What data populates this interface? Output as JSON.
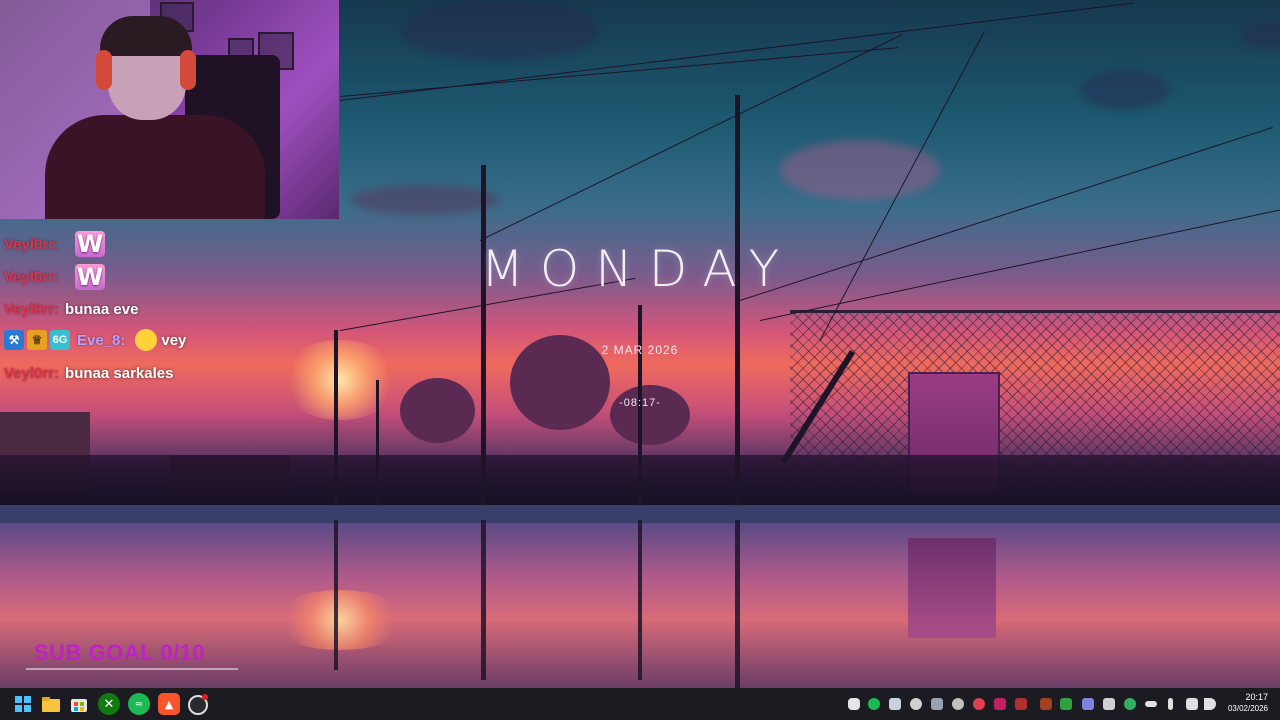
{
  "desktop": {
    "widget": {
      "day": "MONDAY",
      "date": "2 MAR 2026",
      "time": "-08:17-"
    }
  },
  "webcam": {
    "label": "streamer webcam"
  },
  "chat": {
    "messages": [
      {
        "user": "Veyl0rr:",
        "emote": "W",
        "text": ""
      },
      {
        "user": "Veyl0rr:",
        "emote": "W",
        "text": ""
      },
      {
        "user": "Veyl0rr:",
        "emote": "",
        "text": "bunaa eve"
      },
      {
        "user": "Eve_8:",
        "emote": "duck",
        "text": "vey",
        "badges": [
          "hammer",
          "crown",
          "6G"
        ]
      },
      {
        "user": "Veyl0rr:",
        "emote": "",
        "text": "bunaa sarkales"
      }
    ]
  },
  "overlay": {
    "sub_goal": "SUB GOAL 0/10"
  },
  "taskbar": {
    "pinned": [
      "windows-start",
      "file-explorer",
      "microsoft-store",
      "xbox",
      "spotify",
      "brave",
      "obs"
    ],
    "tray_clock": {
      "time": "20:17",
      "date": "03/02/2026"
    }
  },
  "colors": {
    "chat_username": "#e0304a",
    "chat_username_alt": "#b8a0ff",
    "sub_goal": "#c020c8",
    "taskbar_bg": "#1c1b22"
  }
}
